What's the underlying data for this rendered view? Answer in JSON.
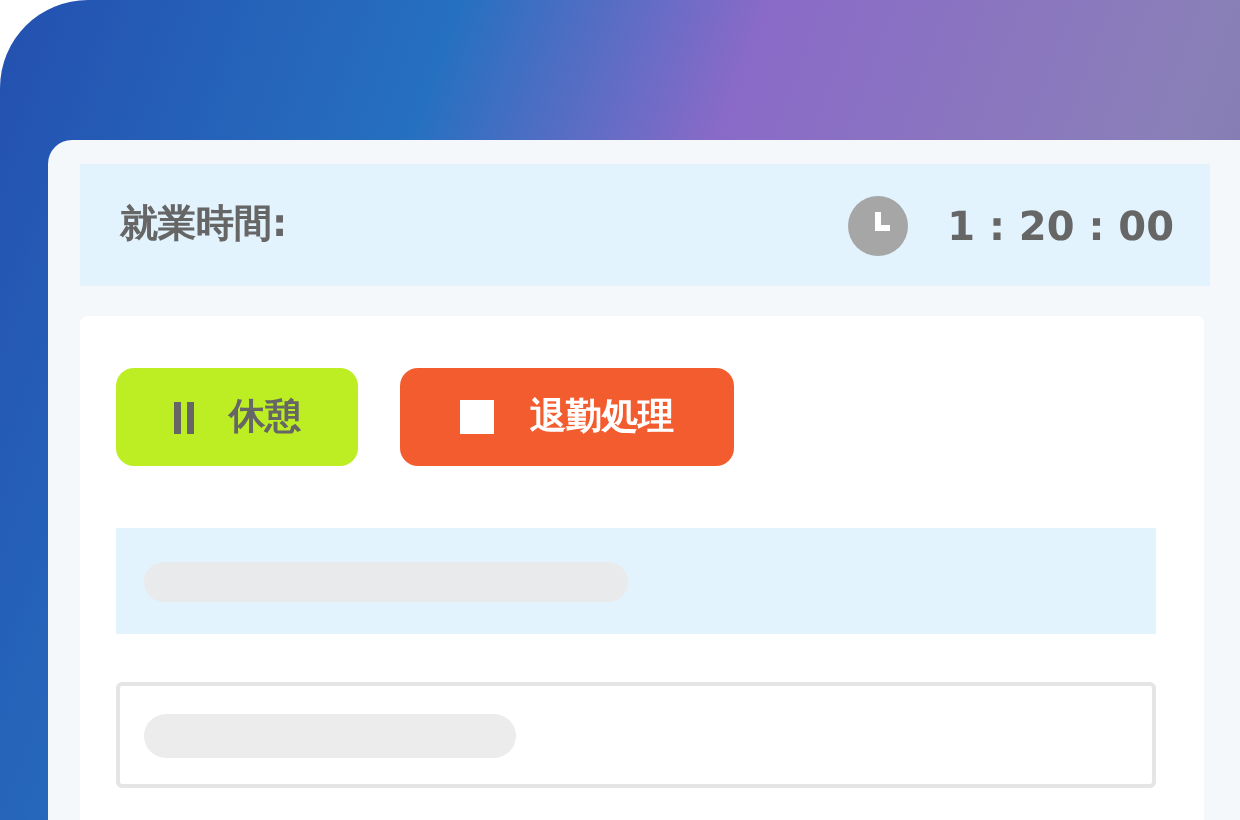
{
  "header": {
    "label": "就業時間:",
    "time": "1 : 20 : 00"
  },
  "buttons": [
    {
      "kind": "pause",
      "label": "休憩"
    },
    {
      "kind": "stop",
      "label": "退勤処理"
    }
  ]
}
